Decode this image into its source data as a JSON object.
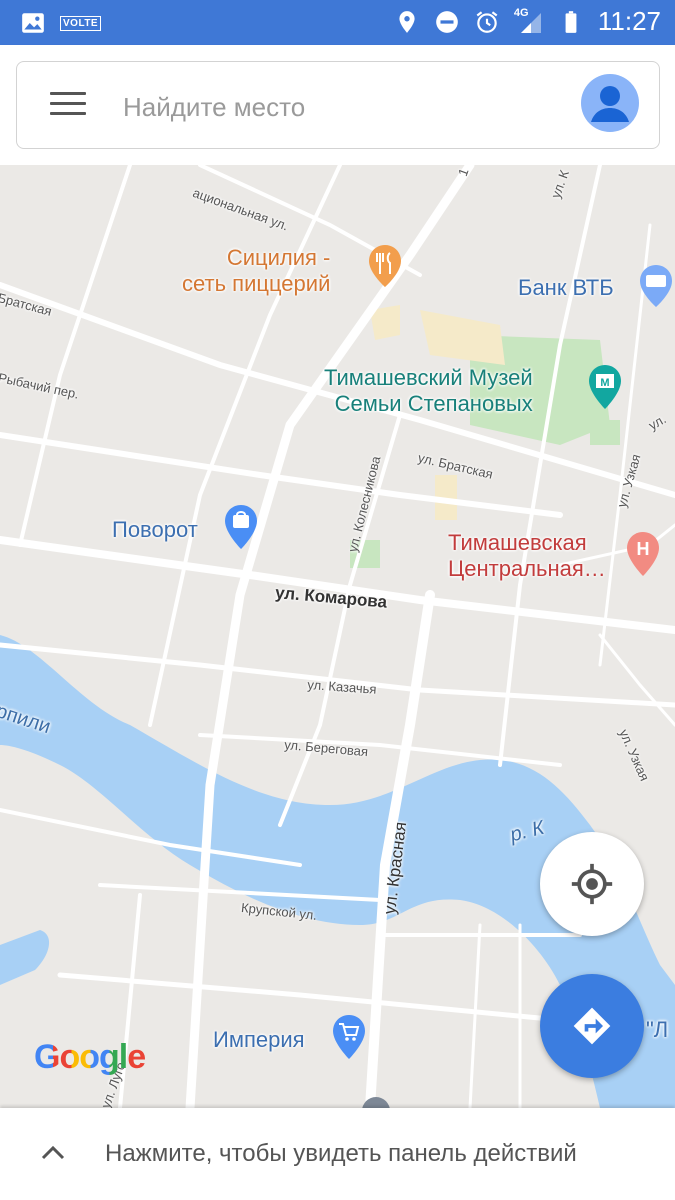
{
  "status_bar": {
    "volte": "VOLTE",
    "network": "4G",
    "time": "11:27",
    "icons": [
      "gallery-icon",
      "location-icon",
      "dnd-icon",
      "alarm-icon",
      "signal-icon",
      "battery-icon"
    ]
  },
  "search": {
    "placeholder": "Найдите место",
    "value": ""
  },
  "map": {
    "pois": {
      "sicilia_line1": "Сицилия -",
      "sicilia_line2": "сеть пиццерий",
      "bank": "Банк ВТБ",
      "museum_line1": "Тимашевский Музей",
      "museum_line2": "Семьи Степановых",
      "povorot": "Поворот",
      "hospital_line1": "Тимашевская",
      "hospital_line2": "Центральная…",
      "imperia": "Империя"
    },
    "streets": {
      "natsionalnaya": "ациональная ул.",
      "bratskaya_left": "Братская",
      "rybachiy": "Рыбачий пер.",
      "bratskaya": "ул. Братская",
      "kolesnikova": "ул. Колесникова",
      "komarova": "ул. Комарова",
      "kazachya": "ул. Казачья",
      "beregovaya": "ул. Береговая",
      "krasnaya": "ул. Красная",
      "uzkaya_top": "ул. Узкая",
      "uzkaya_bottom": "ул. Узкая",
      "krupskoy": "Крупской ул.",
      "river_left": "рпили",
      "river_right": "р. К",
      "lugo": "ул. Луго",
      "edge_ul": "ул.",
      "edge_l": "\"Л",
      "top_k": "ул. К",
      "top_num": "1"
    },
    "colors": {
      "water": "#a8d0f5",
      "land": "#ebe9e6",
      "road": "#ffffff",
      "park": "#c8e6c0",
      "commercial": "#f5eac9"
    }
  },
  "brand": {
    "logo": "Google"
  },
  "bottom_panel": {
    "label": "Нажмите, чтобы увидеть панель действий"
  }
}
